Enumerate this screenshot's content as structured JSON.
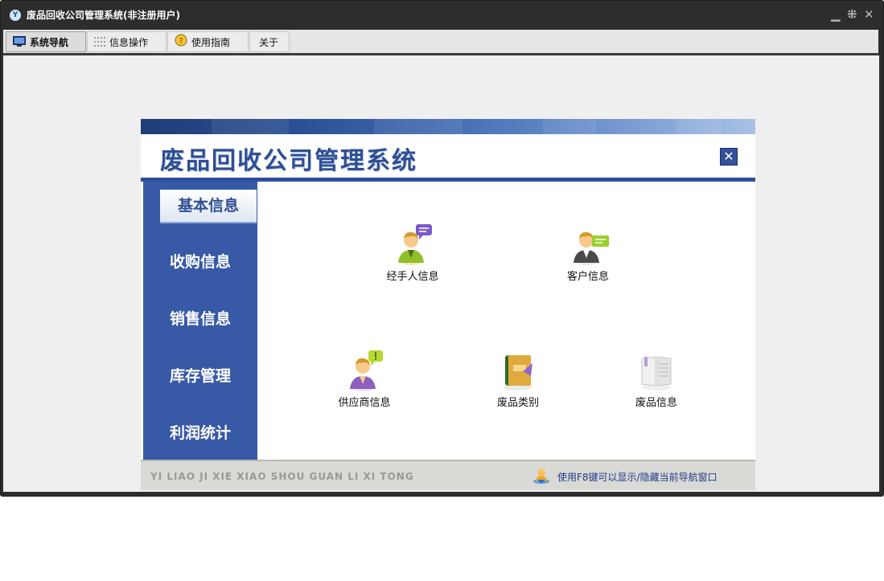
{
  "window": {
    "title": "废品回收公司管理系统(非注册用户)",
    "logo_text": "Y",
    "controls": [
      "minimize-icon",
      "restore-icon",
      "close-icon"
    ]
  },
  "menu": {
    "items": [
      {
        "label": "系统导航",
        "icon": "monitor-icon",
        "active": true
      },
      {
        "label": "信息操作",
        "icon": "grid-icon",
        "active": false
      },
      {
        "label": "使用指南",
        "icon": "help-circle-icon",
        "active": false
      },
      {
        "label": "关于",
        "icon": "",
        "active": false
      }
    ]
  },
  "panel": {
    "title": "废品回收公司管理系统",
    "close_icon": "close-mail-icon",
    "sidebar": [
      {
        "label": "基本信息",
        "active": true
      },
      {
        "label": "收购信息",
        "active": false
      },
      {
        "label": "销售信息",
        "active": false
      },
      {
        "label": "库存管理",
        "active": false
      },
      {
        "label": "利润统计",
        "active": false
      }
    ],
    "apps": [
      {
        "label": "经手人信息",
        "icon": "person-chat-icon"
      },
      {
        "label": "客户信息",
        "icon": "person-card-icon"
      },
      {
        "label": "供应商信息",
        "icon": "person-alert-icon"
      },
      {
        "label": "废品类别",
        "icon": "notebook-icon"
      },
      {
        "label": "废品信息",
        "icon": "book-icon"
      }
    ],
    "footer": {
      "pinyin": "YI LIAO JI XIE XIAO SHOU GUAN LI XI TONG",
      "hint": "使用F8键可以显示/隐藏当前导航窗口",
      "hint_icon": "user-download-icon"
    }
  },
  "colors": {
    "titlebar": "#2d2d2d",
    "sidebar": "#3759a6",
    "accent": "#2e4f94",
    "footer": "#d9d9d6"
  }
}
